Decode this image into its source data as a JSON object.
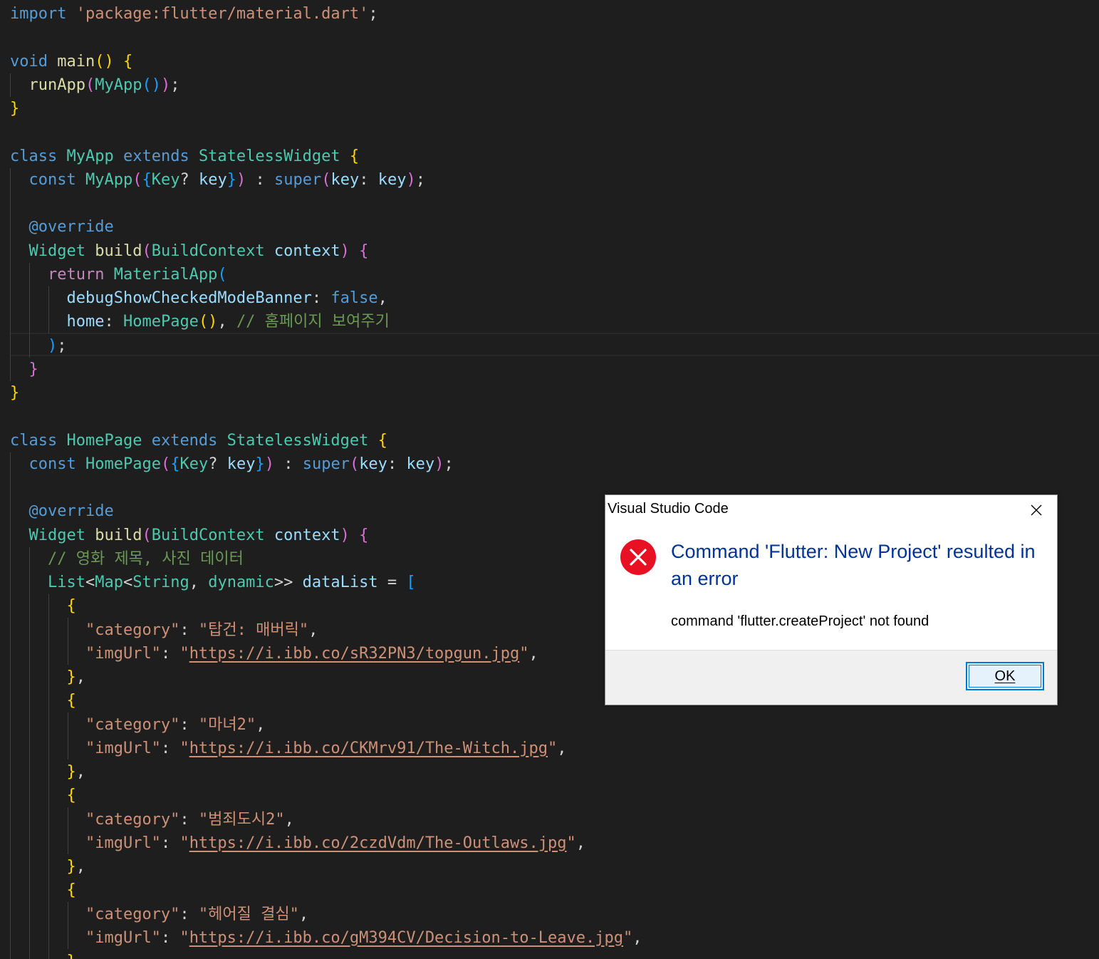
{
  "editor": {
    "lines": [
      [
        [
          "kw",
          "import"
        ],
        [
          "pl",
          " "
        ],
        [
          "st",
          "'package:flutter/material.dart'"
        ],
        [
          "pl",
          ";"
        ]
      ],
      [],
      [
        [
          "kw",
          "void"
        ],
        [
          "pl",
          " "
        ],
        [
          "fn",
          "main"
        ],
        [
          "p1",
          "()"
        ],
        [
          "pl",
          " "
        ],
        [
          "p1",
          "{"
        ]
      ],
      [
        [
          "pl",
          "  "
        ],
        [
          "fn",
          "runApp"
        ],
        [
          "p2",
          "("
        ],
        [
          "ty",
          "MyApp"
        ],
        [
          "p3",
          "()"
        ],
        [
          "p2",
          ")"
        ],
        [
          "pl",
          ";"
        ]
      ],
      [
        [
          "p1",
          "}"
        ]
      ],
      [],
      [
        [
          "kw",
          "class"
        ],
        [
          "pl",
          " "
        ],
        [
          "ty",
          "MyApp"
        ],
        [
          "pl",
          " "
        ],
        [
          "kw",
          "extends"
        ],
        [
          "pl",
          " "
        ],
        [
          "ty",
          "StatelessWidget"
        ],
        [
          "pl",
          " "
        ],
        [
          "p1",
          "{"
        ]
      ],
      [
        [
          "pl",
          "  "
        ],
        [
          "kw",
          "const"
        ],
        [
          "pl",
          " "
        ],
        [
          "ty",
          "MyApp"
        ],
        [
          "p2",
          "("
        ],
        [
          "p3",
          "{"
        ],
        [
          "ty",
          "Key"
        ],
        [
          "pl",
          "? "
        ],
        [
          "va",
          "key"
        ],
        [
          "p3",
          "}"
        ],
        [
          "p2",
          ")"
        ],
        [
          "pl",
          " : "
        ],
        [
          "kw",
          "super"
        ],
        [
          "p2",
          "("
        ],
        [
          "va",
          "key"
        ],
        [
          "pl",
          ": "
        ],
        [
          "va",
          "key"
        ],
        [
          "p2",
          ")"
        ],
        [
          "pl",
          ";"
        ]
      ],
      [],
      [
        [
          "pl",
          "  "
        ],
        [
          "kw",
          "@override"
        ]
      ],
      [
        [
          "pl",
          "  "
        ],
        [
          "ty",
          "Widget"
        ],
        [
          "pl",
          " "
        ],
        [
          "fn",
          "build"
        ],
        [
          "p2",
          "("
        ],
        [
          "ty",
          "BuildContext"
        ],
        [
          "pl",
          " "
        ],
        [
          "va",
          "context"
        ],
        [
          "p2",
          ")"
        ],
        [
          "pl",
          " "
        ],
        [
          "p2",
          "{"
        ]
      ],
      [
        [
          "pl",
          "    "
        ],
        [
          "kc",
          "return"
        ],
        [
          "pl",
          " "
        ],
        [
          "ty",
          "MaterialApp"
        ],
        [
          "p3",
          "("
        ]
      ],
      [
        [
          "pl",
          "      "
        ],
        [
          "va",
          "debugShowCheckedModeBanner"
        ],
        [
          "pl",
          ": "
        ],
        [
          "kw",
          "false"
        ],
        [
          "pl",
          ","
        ]
      ],
      [
        [
          "pl",
          "      "
        ],
        [
          "va",
          "home"
        ],
        [
          "pl",
          ": "
        ],
        [
          "ty",
          "HomePage"
        ],
        [
          "p1",
          "()"
        ],
        [
          "pl",
          ", "
        ],
        [
          "cm",
          "// 홈페이지 보여주기"
        ]
      ],
      [
        [
          "pl",
          "    "
        ],
        [
          "p3",
          ")"
        ],
        [
          "pl",
          ";"
        ]
      ],
      [
        [
          "pl",
          "  "
        ],
        [
          "p2",
          "}"
        ]
      ],
      [
        [
          "p1",
          "}"
        ]
      ],
      [],
      [
        [
          "kw",
          "class"
        ],
        [
          "pl",
          " "
        ],
        [
          "ty",
          "HomePage"
        ],
        [
          "pl",
          " "
        ],
        [
          "kw",
          "extends"
        ],
        [
          "pl",
          " "
        ],
        [
          "ty",
          "StatelessWidget"
        ],
        [
          "pl",
          " "
        ],
        [
          "p1",
          "{"
        ]
      ],
      [
        [
          "pl",
          "  "
        ],
        [
          "kw",
          "const"
        ],
        [
          "pl",
          " "
        ],
        [
          "ty",
          "HomePage"
        ],
        [
          "p2",
          "("
        ],
        [
          "p3",
          "{"
        ],
        [
          "ty",
          "Key"
        ],
        [
          "pl",
          "? "
        ],
        [
          "va",
          "key"
        ],
        [
          "p3",
          "}"
        ],
        [
          "p2",
          ")"
        ],
        [
          "pl",
          " : "
        ],
        [
          "kw",
          "super"
        ],
        [
          "p2",
          "("
        ],
        [
          "va",
          "key"
        ],
        [
          "pl",
          ": "
        ],
        [
          "va",
          "key"
        ],
        [
          "p2",
          ")"
        ],
        [
          "pl",
          ";"
        ]
      ],
      [],
      [
        [
          "pl",
          "  "
        ],
        [
          "kw",
          "@override"
        ]
      ],
      [
        [
          "pl",
          "  "
        ],
        [
          "ty",
          "Widget"
        ],
        [
          "pl",
          " "
        ],
        [
          "fn",
          "build"
        ],
        [
          "p2",
          "("
        ],
        [
          "ty",
          "BuildContext"
        ],
        [
          "pl",
          " "
        ],
        [
          "va",
          "context"
        ],
        [
          "p2",
          ")"
        ],
        [
          "pl",
          " "
        ],
        [
          "p2",
          "{"
        ]
      ],
      [
        [
          "pl",
          "    "
        ],
        [
          "cm",
          "// 영화 제목, 사진 데이터"
        ]
      ],
      [
        [
          "pl",
          "    "
        ],
        [
          "ty",
          "List"
        ],
        [
          "pl",
          "<"
        ],
        [
          "ty",
          "Map"
        ],
        [
          "pl",
          "<"
        ],
        [
          "ty",
          "String"
        ],
        [
          "pl",
          ", "
        ],
        [
          "ty",
          "dynamic"
        ],
        [
          "pl",
          ">> "
        ],
        [
          "va",
          "dataList"
        ],
        [
          "pl",
          " = "
        ],
        [
          "p3",
          "["
        ]
      ],
      [
        [
          "pl",
          "      "
        ],
        [
          "p1",
          "{"
        ]
      ],
      [
        [
          "pl",
          "        "
        ],
        [
          "st",
          "\"category\""
        ],
        [
          "pl",
          ": "
        ],
        [
          "st",
          "\"탑건: 매버릭\""
        ],
        [
          "pl",
          ","
        ]
      ],
      [
        [
          "pl",
          "        "
        ],
        [
          "st",
          "\"imgUrl\""
        ],
        [
          "pl",
          ": "
        ],
        [
          "st",
          "\""
        ],
        [
          "lnk",
          "https://i.ibb.co/sR32PN3/topgun.jpg"
        ],
        [
          "st",
          "\""
        ],
        [
          "pl",
          ","
        ]
      ],
      [
        [
          "pl",
          "      "
        ],
        [
          "p1",
          "}"
        ],
        [
          "pl",
          ","
        ]
      ],
      [
        [
          "pl",
          "      "
        ],
        [
          "p1",
          "{"
        ]
      ],
      [
        [
          "pl",
          "        "
        ],
        [
          "st",
          "\"category\""
        ],
        [
          "pl",
          ": "
        ],
        [
          "st",
          "\"마녀2\""
        ],
        [
          "pl",
          ","
        ]
      ],
      [
        [
          "pl",
          "        "
        ],
        [
          "st",
          "\"imgUrl\""
        ],
        [
          "pl",
          ": "
        ],
        [
          "st",
          "\""
        ],
        [
          "lnk",
          "https://i.ibb.co/CKMrv91/The-Witch.jpg"
        ],
        [
          "st",
          "\""
        ],
        [
          "pl",
          ","
        ]
      ],
      [
        [
          "pl",
          "      "
        ],
        [
          "p1",
          "}"
        ],
        [
          "pl",
          ","
        ]
      ],
      [
        [
          "pl",
          "      "
        ],
        [
          "p1",
          "{"
        ]
      ],
      [
        [
          "pl",
          "        "
        ],
        [
          "st",
          "\"category\""
        ],
        [
          "pl",
          ": "
        ],
        [
          "st",
          "\"범죄도시2\""
        ],
        [
          "pl",
          ","
        ]
      ],
      [
        [
          "pl",
          "        "
        ],
        [
          "st",
          "\"imgUrl\""
        ],
        [
          "pl",
          ": "
        ],
        [
          "st",
          "\""
        ],
        [
          "lnk",
          "https://i.ibb.co/2czdVdm/The-Outlaws.jpg"
        ],
        [
          "st",
          "\""
        ],
        [
          "pl",
          ","
        ]
      ],
      [
        [
          "pl",
          "      "
        ],
        [
          "p1",
          "}"
        ],
        [
          "pl",
          ","
        ]
      ],
      [
        [
          "pl",
          "      "
        ],
        [
          "p1",
          "{"
        ]
      ],
      [
        [
          "pl",
          "        "
        ],
        [
          "st",
          "\"category\""
        ],
        [
          "pl",
          ": "
        ],
        [
          "st",
          "\"헤어질 결심\""
        ],
        [
          "pl",
          ","
        ]
      ],
      [
        [
          "pl",
          "        "
        ],
        [
          "st",
          "\"imgUrl\""
        ],
        [
          "pl",
          ": "
        ],
        [
          "st",
          "\""
        ],
        [
          "lnk",
          "https://i.ibb.co/gM394CV/Decision-to-Leave.jpg"
        ],
        [
          "st",
          "\""
        ],
        [
          "pl",
          ","
        ]
      ],
      [
        [
          "pl",
          "      "
        ],
        [
          "p1",
          "}"
        ],
        [
          "pl",
          ","
        ]
      ]
    ]
  },
  "dialog": {
    "title": "Visual Studio Code",
    "close_icon": "close-icon",
    "error_icon": "error-circle-icon",
    "heading": "Command 'Flutter: New Project' resulted in an error",
    "detail": "command 'flutter.createProject' not found",
    "ok_label": "OK"
  },
  "colors": {
    "editor_background": "#1e1e1e",
    "error_red": "#e81123",
    "heading_blue": "#003399",
    "button_focus": "#0078d7"
  }
}
